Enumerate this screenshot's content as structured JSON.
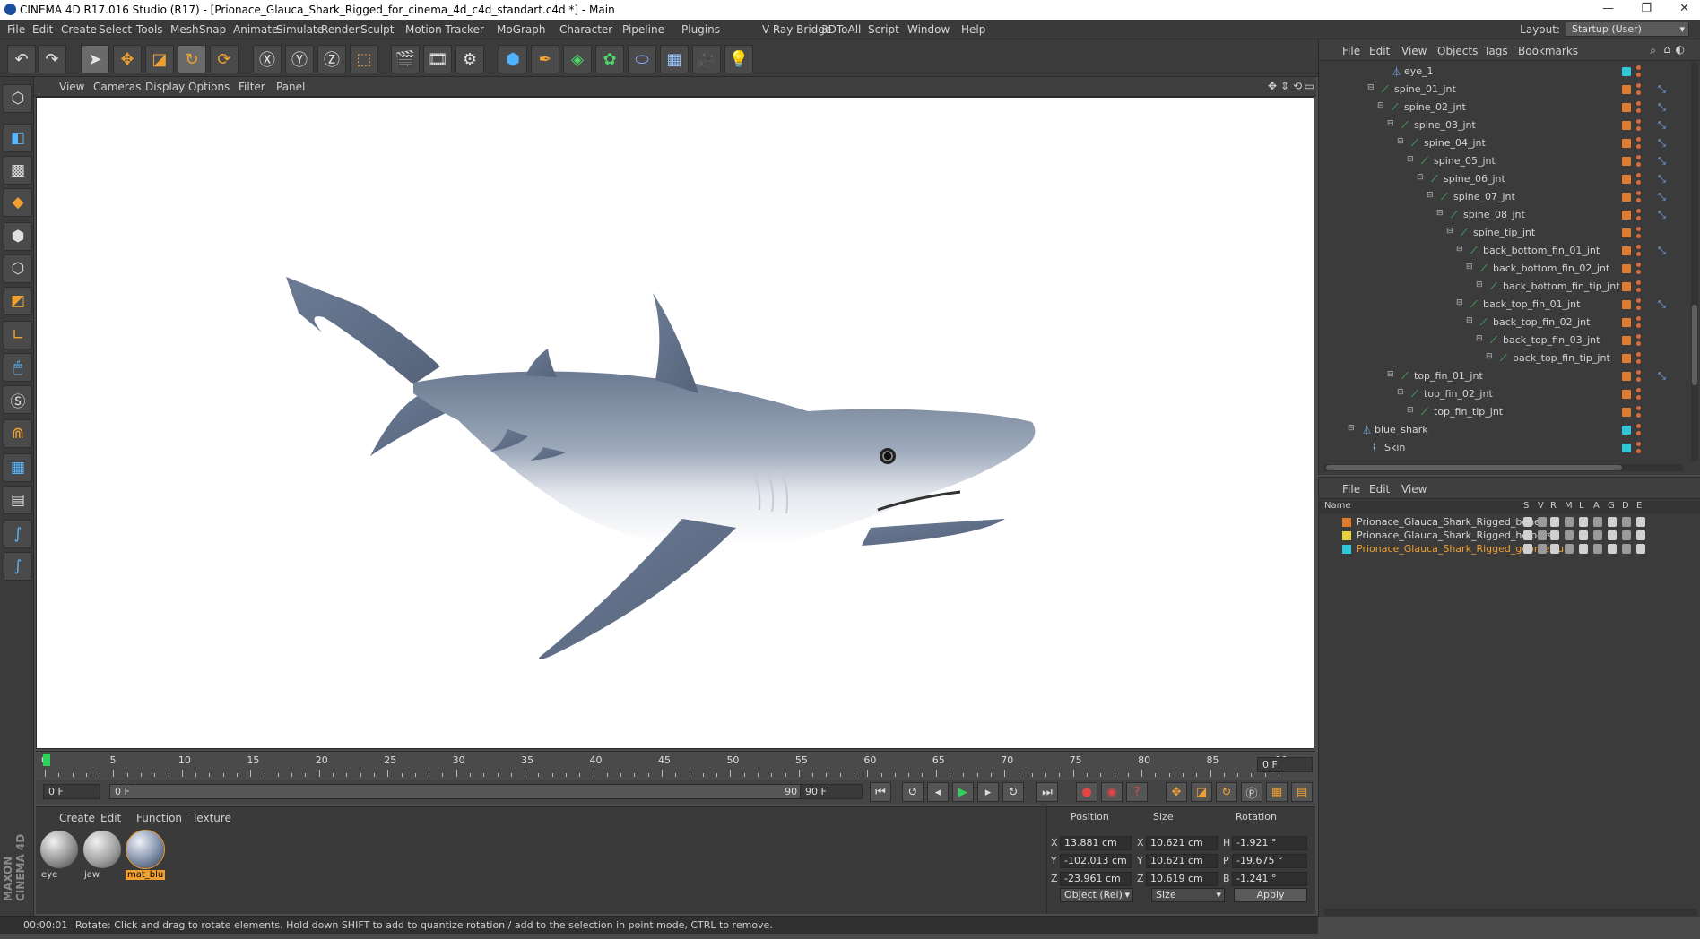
{
  "window": {
    "title": "CINEMA 4D R17.016 Studio (R17) - [Prionace_Glauca_Shark_Rigged_for_cinema_4d_c4d_standart.c4d *] - Main",
    "minimize": "—",
    "restore": "❐",
    "close": "✕"
  },
  "menu": {
    "items": [
      "File",
      "Edit",
      "Create",
      "Select",
      "Tools",
      "Mesh",
      "Snap",
      "Animate",
      "Simulate",
      "Render",
      "Sculpt",
      "Motion Tracker",
      "MoGraph",
      "Character",
      "Pipeline",
      "Plugins",
      "V-Ray Bridge",
      "3DToAll",
      "Script",
      "Window",
      "Help"
    ],
    "layout_label": "Layout:",
    "layout_value": "Startup (User)"
  },
  "viewport": {
    "menu": [
      "View",
      "Cameras",
      "Display",
      "Options",
      "Filter",
      "Panel"
    ]
  },
  "timeline": {
    "ticks": [
      "0",
      "5",
      "10",
      "15",
      "20",
      "25",
      "30",
      "35",
      "40",
      "45",
      "50",
      "55",
      "60",
      "65",
      "70",
      "75",
      "80",
      "85",
      "90"
    ],
    "current_frame": "0 F",
    "start_field": "0 F",
    "range_start": "0 F",
    "range_end": "90 F",
    "end_field": "90 F"
  },
  "materials": {
    "menu": [
      "Create",
      "Edit",
      "Function",
      "Texture"
    ],
    "items": [
      {
        "name": "eye"
      },
      {
        "name": "jaw"
      },
      {
        "name": "mat_blu"
      }
    ]
  },
  "attributes": {
    "headers": {
      "position": "Position",
      "size": "Size",
      "rotation": "Rotation"
    },
    "rows": [
      {
        "axis": "X",
        "pos": "13.881 cm",
        "saxis": "X",
        "size": "10.621 cm",
        "raxis": "H",
        "rot": "-1.921 °"
      },
      {
        "axis": "Y",
        "pos": "-102.013 cm",
        "saxis": "Y",
        "size": "10.621 cm",
        "raxis": "P",
        "rot": "-19.675 °"
      },
      {
        "axis": "Z",
        "pos": "-23.961 cm",
        "saxis": "Z",
        "size": "10.619 cm",
        "raxis": "B",
        "rot": "-1.241 °"
      }
    ],
    "mode": "Object (Rel)",
    "size_mode": "Size",
    "apply": "Apply"
  },
  "status": {
    "time": "00:00:01",
    "message": "Rotate: Click and drag to rotate elements. Hold down SHIFT to add to quantize rotation / add to the selection in point mode, CTRL to remove."
  },
  "objects": {
    "menu": [
      "File",
      "Edit",
      "View",
      "Objects",
      "Tags",
      "Bookmarks"
    ],
    "tree": [
      {
        "name": "eye_1",
        "depth": 3,
        "type": "null",
        "tag": "cyan",
        "ik": false
      },
      {
        "name": "spine_01_jnt",
        "depth": 2,
        "type": "joint",
        "tag": "orange",
        "ik": true
      },
      {
        "name": "spine_02_jnt",
        "depth": 3,
        "type": "joint",
        "tag": "orange",
        "ik": true
      },
      {
        "name": "spine_03_jnt",
        "depth": 4,
        "type": "joint",
        "tag": "orange",
        "ik": true
      },
      {
        "name": "spine_04_jnt",
        "depth": 5,
        "type": "joint",
        "tag": "orange",
        "ik": true
      },
      {
        "name": "spine_05_jnt",
        "depth": 6,
        "type": "joint",
        "tag": "orange",
        "ik": true
      },
      {
        "name": "spine_06_jnt",
        "depth": 7,
        "type": "joint",
        "tag": "orange",
        "ik": true
      },
      {
        "name": "spine_07_jnt",
        "depth": 8,
        "type": "joint",
        "tag": "orange",
        "ik": true
      },
      {
        "name": "spine_08_jnt",
        "depth": 9,
        "type": "joint",
        "tag": "orange",
        "ik": true
      },
      {
        "name": "spine_tip_jnt",
        "depth": 10,
        "type": "joint",
        "tag": "orange",
        "ik": false
      },
      {
        "name": "back_bottom_fin_01_jnt",
        "depth": 11,
        "type": "joint",
        "tag": "orange",
        "ik": true
      },
      {
        "name": "back_bottom_fin_02_jnt",
        "depth": 12,
        "type": "joint",
        "tag": "orange",
        "ik": false
      },
      {
        "name": "back_bottom_fin_tip_jnt",
        "depth": 13,
        "type": "joint",
        "tag": "orange",
        "ik": false
      },
      {
        "name": "back_top_fin_01_jnt",
        "depth": 11,
        "type": "joint",
        "tag": "orange",
        "ik": true
      },
      {
        "name": "back_top_fin_02_jnt",
        "depth": 12,
        "type": "joint",
        "tag": "orange",
        "ik": false
      },
      {
        "name": "back_top_fin_03_jnt",
        "depth": 13,
        "type": "joint",
        "tag": "orange",
        "ik": false
      },
      {
        "name": "back_top_fin_tip_jnt",
        "depth": 14,
        "type": "joint",
        "tag": "orange",
        "ik": false
      },
      {
        "name": "top_fin_01_jnt",
        "depth": 4,
        "type": "joint",
        "tag": "orange",
        "ik": true
      },
      {
        "name": "top_fin_02_jnt",
        "depth": 5,
        "type": "joint",
        "tag": "orange",
        "ik": false
      },
      {
        "name": "top_fin_tip_jnt",
        "depth": 6,
        "type": "joint",
        "tag": "orange",
        "ik": false
      },
      {
        "name": "blue_shark",
        "depth": 0,
        "type": "null",
        "tag": "cyan",
        "ik": false
      },
      {
        "name": "Skin",
        "depth": 1,
        "type": "skin",
        "tag": "cyan",
        "ik": false
      }
    ]
  },
  "layers": {
    "menu": [
      "File",
      "Edit",
      "View"
    ],
    "headers": [
      "Name",
      "S",
      "V",
      "R",
      "M",
      "L",
      "A",
      "G",
      "D",
      "E"
    ],
    "items": [
      {
        "name": "Prionace_Glauca_Shark_Rigged_bones",
        "color": "#e07a2c",
        "selected": false
      },
      {
        "name": "Prionace_Glauca_Shark_Rigged_helpers",
        "color": "#e8d23a",
        "selected": false
      },
      {
        "name": "Prionace_Glauca_Shark_Rigged_geometru",
        "color": "#2ec7d8",
        "selected": true
      }
    ]
  },
  "logo": "MAXON CINEMA 4D"
}
